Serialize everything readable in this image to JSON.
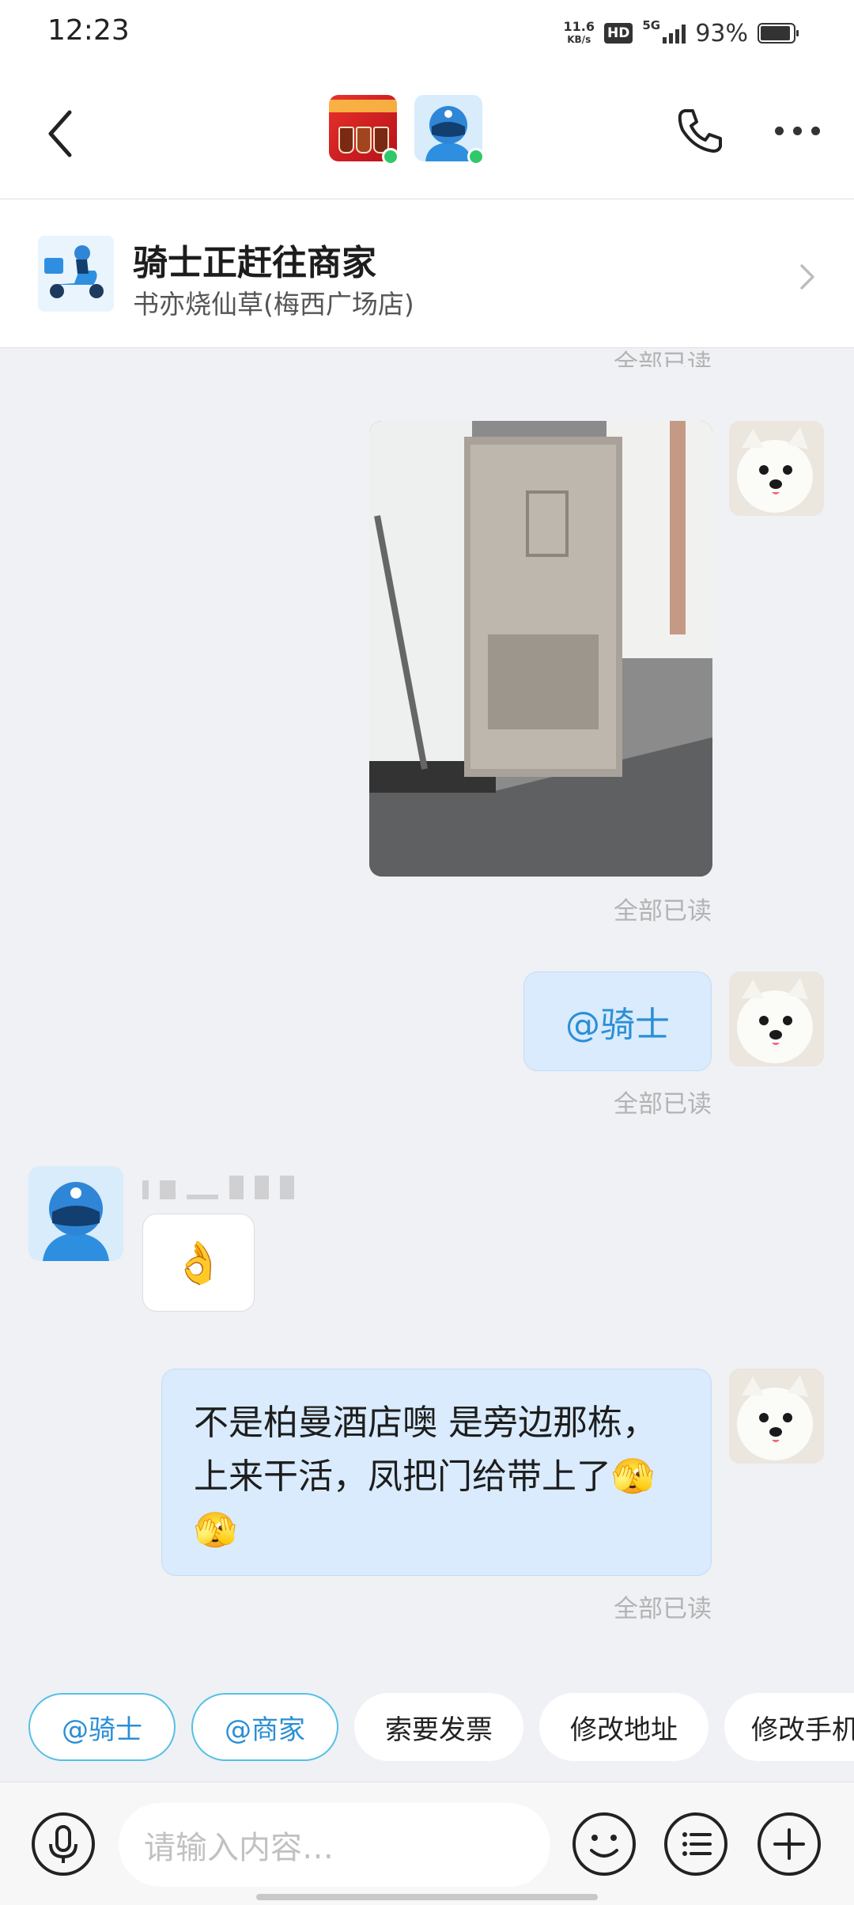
{
  "status_bar": {
    "time": "12:23",
    "net_speed_value": "11.6",
    "net_speed_unit": "KB/s",
    "hd": "HD",
    "network": "5G",
    "battery": "93%"
  },
  "header": {
    "back_icon": "chevron-left-icon",
    "call_icon": "phone-icon",
    "more_icon": "more-dots-icon"
  },
  "order_card": {
    "title": "骑士正赶往商家",
    "store": "书亦烧仙草(梅西广场店)"
  },
  "messages": {
    "read_top": "全部已读",
    "read_photo": "全部已读",
    "at_rider_text": "@骑士",
    "read_at": "全部已读",
    "ok_emoji": "👌",
    "long_text": "不是柏曼酒店噢  是旁边那栋， 上来干活，凤把门给带上了🫣🫣",
    "read_long": "全部已读"
  },
  "quick_actions": {
    "at_rider": "@骑士",
    "at_merchant": "@商家",
    "invoice": "索要发票",
    "edit_address": "修改地址",
    "edit_phone": "修改手机"
  },
  "input_bar": {
    "placeholder": "请输入内容…",
    "mic_icon": "microphone-icon",
    "emoji_icon": "smiley-icon",
    "menu_icon": "list-icon",
    "add_icon": "plus-icon"
  },
  "colors": {
    "accent": "#2a8fd6",
    "my_bubble": "#d9ebfc",
    "online": "#2fc86a",
    "background": "#eff1f5"
  }
}
